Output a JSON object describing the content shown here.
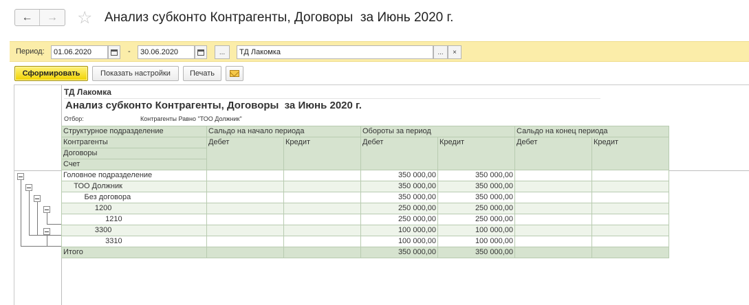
{
  "window": {
    "title": "Анализ субконто Контрагенты, Договоры  за Июнь 2020 г."
  },
  "nav": {
    "back_icon": "←",
    "forward_icon": "→",
    "favorite_icon": "☆"
  },
  "period": {
    "label": "Период:",
    "from": "01.06.2020",
    "dash": "-",
    "to": "30.06.2020",
    "choose_label": "...",
    "org_value": "ТД Лакомка",
    "org_select_label": "...",
    "org_clear_label": "×"
  },
  "toolbar": {
    "generate_label": "Сформировать",
    "settings_label": "Показать настройки",
    "print_label": "Печать"
  },
  "report": {
    "organization": "ТД Лакомка",
    "title": "Анализ субконто Контрагенты, Договоры  за Июнь 2020 г.",
    "filter_label": "Отбор:",
    "filter_value": "Контрагенты Равно \"ТОО Должник\"",
    "header": {
      "row_dims": [
        "Структурное подразделение",
        "Контрагенты",
        "Договоры",
        "Счет"
      ],
      "group_start": "Сальдо на начало периода",
      "group_turnover": "Обороты за период",
      "group_end": "Сальдо на конец периода",
      "debit": "Дебет",
      "credit": "Кредит"
    },
    "rows": [
      {
        "name": "Головное подразделение",
        "turn_debit": "350 000,00",
        "turn_credit": "350 000,00"
      },
      {
        "name": "     ТОО Должник",
        "turn_debit": "350 000,00",
        "turn_credit": "350 000,00"
      },
      {
        "name": "          Без договора",
        "turn_debit": "350 000,00",
        "turn_credit": "350 000,00"
      },
      {
        "name": "               1200",
        "turn_debit": "250 000,00",
        "turn_credit": "250 000,00"
      },
      {
        "name": "                    1210",
        "turn_debit": "250 000,00",
        "turn_credit": "250 000,00"
      },
      {
        "name": "               3300",
        "turn_debit": "100 000,00",
        "turn_credit": "100 000,00"
      },
      {
        "name": "                    3310",
        "turn_debit": "100 000,00",
        "turn_credit": "100 000,00"
      }
    ],
    "total": {
      "name": "Итого",
      "turn_debit": "350 000,00",
      "turn_credit": "350 000,00"
    }
  }
}
